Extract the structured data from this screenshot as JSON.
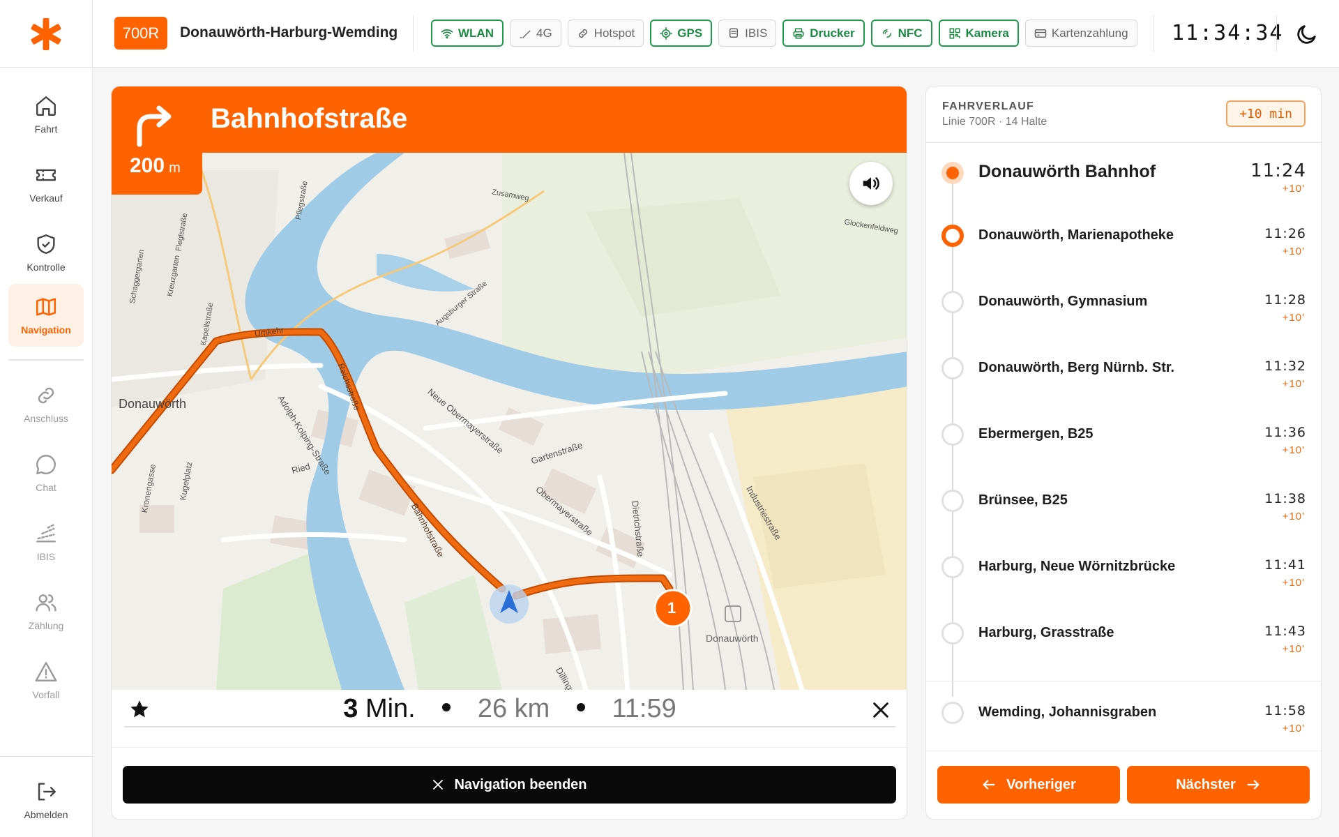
{
  "header": {
    "line_badge": "700R",
    "route_name": "Donauwörth-Harburg-Wemding",
    "status_chips": [
      {
        "label": "WLAN",
        "active": true,
        "icon": "wifi-icon"
      },
      {
        "label": "4G",
        "active": false,
        "icon": "signal-icon"
      },
      {
        "label": "Hotspot",
        "active": false,
        "icon": "link-icon"
      },
      {
        "label": "GPS",
        "active": true,
        "icon": "crosshair-icon"
      },
      {
        "label": "IBIS",
        "active": false,
        "icon": "display-icon"
      },
      {
        "label": "Drucker",
        "active": true,
        "icon": "printer-icon"
      },
      {
        "label": "NFC",
        "active": true,
        "icon": "nfc-icon"
      },
      {
        "label": "Kamera",
        "active": true,
        "icon": "qr-icon"
      },
      {
        "label": "Kartenzahlung",
        "active": false,
        "icon": "card-icon"
      }
    ],
    "clock": "11:34:34",
    "theme_toggle_icon": "moon-icon"
  },
  "sidebar": {
    "items": [
      {
        "label": "Fahrt",
        "icon": "home-icon"
      },
      {
        "label": "Verkauf",
        "icon": "ticket-icon"
      },
      {
        "label": "Kontrolle",
        "icon": "shield-check-icon"
      },
      {
        "label": "Navigation",
        "icon": "map-icon"
      },
      {
        "label": "Anschluss",
        "icon": "link-icon"
      },
      {
        "label": "Chat",
        "icon": "chat-icon"
      },
      {
        "label": "IBIS",
        "icon": "signal-icon"
      },
      {
        "label": "Zählung",
        "icon": "users-icon"
      },
      {
        "label": "Vorfall",
        "icon": "warning-icon"
      }
    ],
    "logout_label": "Abmelden"
  },
  "navigation": {
    "street": "Bahnhofstraße",
    "distance_value": "200",
    "distance_unit": "m",
    "eta_minutes": "3",
    "eta_minutes_unit": "Min.",
    "remaining_distance": "26 km",
    "arrival_time": "11:59",
    "end_button": "Navigation beenden",
    "map_labels": {
      "city": "Donauwörth",
      "station": "Donauwörth",
      "waypoint_number": "1",
      "streets": [
        "Bahnhofstraße",
        "Gartenstraße",
        "Obermayerstraße",
        "Neue Obermayerstraße",
        "Dietrichstraße",
        "Industriestraße",
        "Adolph-Kolping-Straße",
        "Reichsstraße",
        "Kronengasse",
        "Kugelplatz",
        "Ried",
        "Umkehr",
        "Augsburger Straße",
        "Zusamweg",
        "Glockenfeldweg",
        "Dillinger",
        "Kapellstraße",
        "Kreuzgarten",
        "Schaggergarten",
        "Fleglstraße",
        "Pflegstraße"
      ]
    }
  },
  "fahrverlauf": {
    "title": "FAHRVERLAUF",
    "subtitle": "Linie 700R · 14 Halte",
    "delay": "+10 min",
    "stops": [
      {
        "name": "Donauwörth Bahnhof",
        "time": "11:24",
        "delay": "+10'",
        "state": "current"
      },
      {
        "name": "Donauwörth, Marienapotheke",
        "time": "11:26",
        "delay": "+10'",
        "state": "next"
      },
      {
        "name": "Donauwörth, Gymnasium",
        "time": "11:28",
        "delay": "+10'",
        "state": "upcoming"
      },
      {
        "name": "Donauwörth, Berg Nürnb. Str.",
        "time": "11:32",
        "delay": "+10'",
        "state": "upcoming"
      },
      {
        "name": "Ebermergen, B25",
        "time": "11:36",
        "delay": "+10'",
        "state": "upcoming"
      },
      {
        "name": "Brünsee, B25",
        "time": "11:38",
        "delay": "+10'",
        "state": "upcoming"
      },
      {
        "name": "Harburg, Neue Wörnitzbrücke",
        "time": "11:41",
        "delay": "+10'",
        "state": "upcoming"
      },
      {
        "name": "Harburg, Grasstraße",
        "time": "11:43",
        "delay": "+10'",
        "state": "upcoming"
      },
      {
        "name": "Wemding, Johannisgraben",
        "time": "11:58",
        "delay": "+10'",
        "state": "terminal"
      }
    ],
    "prev_button": "Vorheriger",
    "next_button": "Nächster"
  },
  "colors": {
    "accent": "#ff6200",
    "status_on": "#1f9a4a",
    "delay": "#ea6a0d",
    "route": "#f06a10",
    "river": "#8dc2e3"
  }
}
